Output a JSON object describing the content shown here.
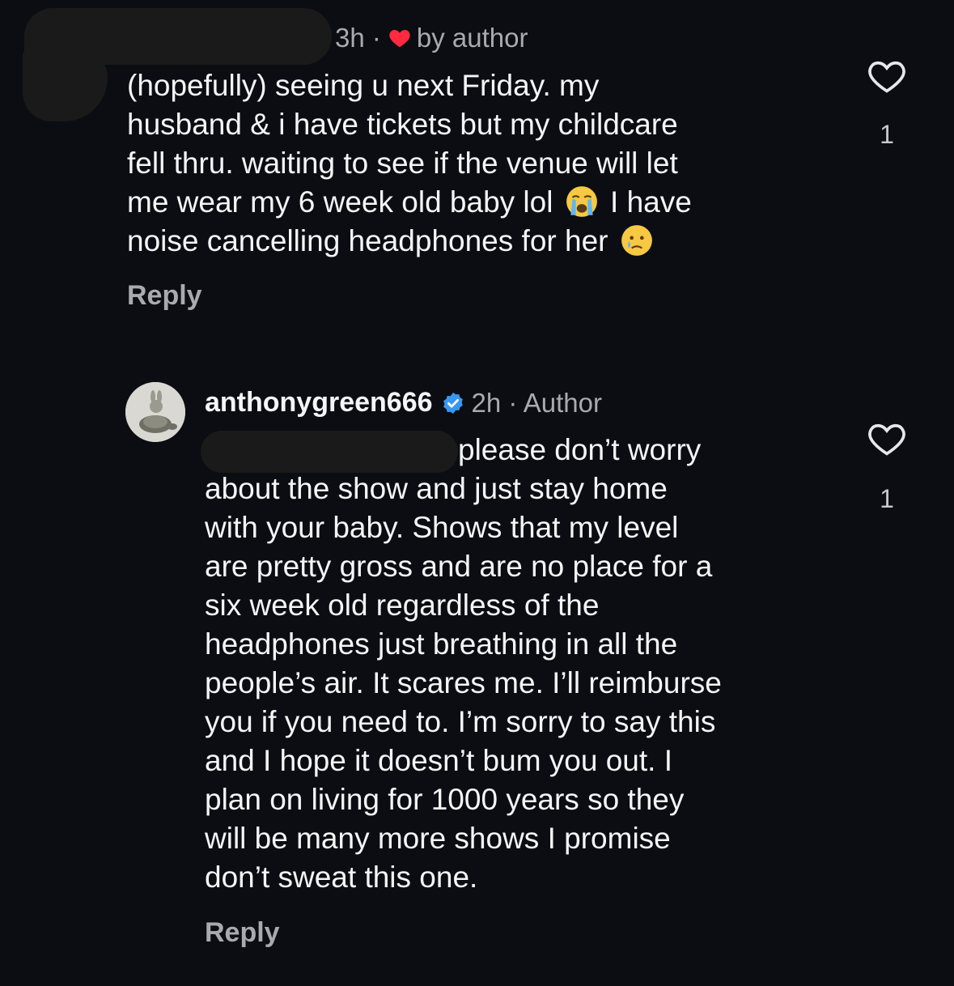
{
  "comment1": {
    "time": "3h ·",
    "badge_text": "by author",
    "text_lines": [
      "(hopefully) seeing u next Friday. my",
      "husband & i have tickets but my childcare",
      "fell thru. waiting to see if the venue will let"
    ],
    "line4_before": "me wear my 6 week old baby lol",
    "line4_after": "I have",
    "line5": "noise cancelling headphones for her",
    "reply_label": "Reply",
    "like_count": "1"
  },
  "comment2": {
    "username": "anthonygreen666",
    "time": "2h · Author",
    "text_line1": "please don’t worry",
    "text_lines": [
      "about the show and just stay home",
      "with your baby. Shows that my level",
      "are pretty gross and are no place for a",
      "six week old regardless of the",
      "headphones just breathing in all the",
      "people’s air. It scares me. I’ll reimburse",
      "you if you need to. I’m sorry to say this",
      "and I hope it doesn’t bum you out. I",
      "plan on living for 1000 years so they",
      "will be many more shows I promise",
      "don’t sweat this one."
    ],
    "reply_label": "Reply",
    "like_count": "1"
  },
  "colors": {
    "background": "#0b0d12",
    "text": "#f4f5f7",
    "muted": "#a8aab0",
    "heart_red": "#ff2a3d",
    "verified_blue": "#3897f0"
  },
  "icons": [
    "red-heart-icon",
    "heart-outline-icon",
    "verified-badge-icon",
    "crying-face-emoji",
    "tear-face-emoji"
  ]
}
